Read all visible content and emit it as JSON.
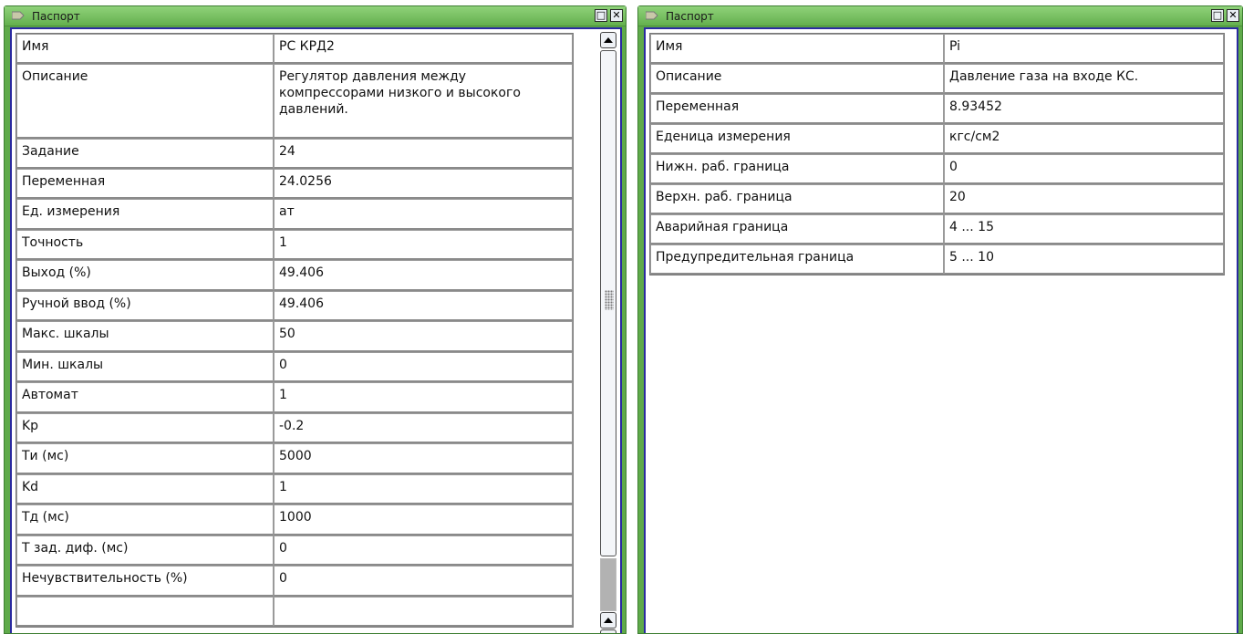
{
  "left_window": {
    "title": "Паспорт",
    "maximize_glyph": "□",
    "close_glyph": "✕",
    "rows": [
      {
        "key": "Имя",
        "value": "РС КРД2"
      },
      {
        "key": "Описание",
        "value": "Регулятор давления между компрессорами низкого и высокого давлений."
      },
      {
        "key": "Задание",
        "value": "24"
      },
      {
        "key": "Переменная",
        "value": "24.0256"
      },
      {
        "key": "Ед. измерения",
        "value": "ат"
      },
      {
        "key": "Точность",
        "value": "1"
      },
      {
        "key": "Выход (%)",
        "value": "49.406"
      },
      {
        "key": "Ручной ввод (%)",
        "value": "49.406"
      },
      {
        "key": "Макс. шкалы",
        "value": "50"
      },
      {
        "key": "Мин. шкалы",
        "value": "0"
      },
      {
        "key": "Автомат",
        "value": "1"
      },
      {
        "key": "Kp",
        "value": "-0.2"
      },
      {
        "key": "Ти (мс)",
        "value": "5000"
      },
      {
        "key": "Kd",
        "value": "1"
      },
      {
        "key": "Тд (мс)",
        "value": "1000"
      },
      {
        "key": "Т зад. диф. (мс)",
        "value": "0"
      },
      {
        "key": "Нечувствительность (%)",
        "value": "0"
      }
    ]
  },
  "right_window": {
    "title": "Паспорт",
    "maximize_glyph": "□",
    "close_glyph": "✕",
    "rows": [
      {
        "key": "Имя",
        "value": "Pi"
      },
      {
        "key": "Описание",
        "value": "Давление газа на входе КС."
      },
      {
        "key": "Переменная",
        "value": "8.93452"
      },
      {
        "key": "Еденица измерения",
        "value": "кгс/см2"
      },
      {
        "key": "Нижн. раб. граница",
        "value": "0"
      },
      {
        "key": "Верхн. раб. граница",
        "value": "20"
      },
      {
        "key": "Аварийная граница",
        "value": "4 ... 15"
      },
      {
        "key": "Предупредительная граница",
        "value": "5 ... 10"
      }
    ]
  },
  "colors": {
    "frame_green": "#5faa4a",
    "content_border": "#2a2aa0",
    "grid_line": "#9a9a9a"
  },
  "icons": {
    "title_icon": "window-menu-icon",
    "scroll_up": "chevron-up-icon",
    "scroll_down": "chevron-down-icon"
  }
}
